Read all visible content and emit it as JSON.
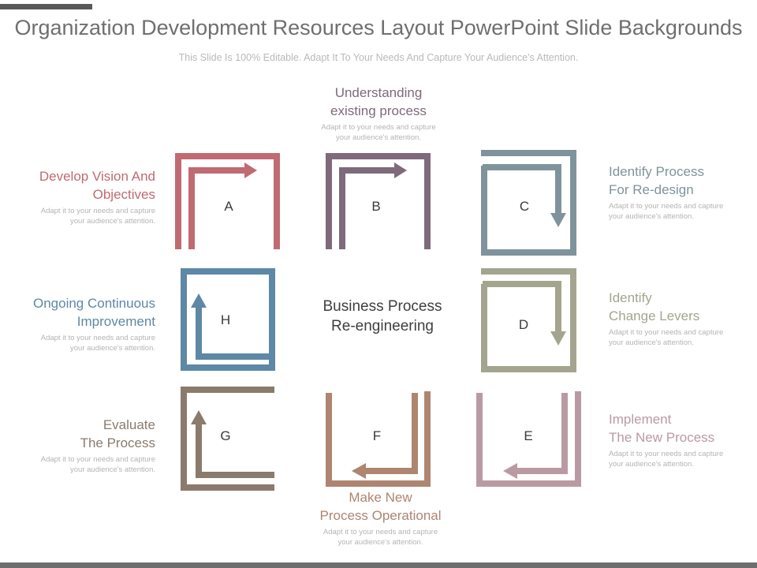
{
  "title": "Organization Development Resources Layout PowerPoint Slide Backgrounds",
  "subtitle": "This Slide Is 100% Editable. Adapt It To Your Needs And Capture Your Audience's Attention.",
  "center": "Business Process\nRe-engineering",
  "steps": [
    {
      "letter": "A",
      "heading": "Develop Vision And\nObjectives",
      "desc": "Adapt it to your needs and capture\nyour audience's attention.",
      "color": "#c06a72"
    },
    {
      "letter": "B",
      "heading": "Understanding\nexisting process",
      "desc": "Adapt it to your needs and capture\nyour audience's attention.",
      "color": "#7e6a7b"
    },
    {
      "letter": "C",
      "heading": "Identify Process\nFor Re-design",
      "desc": "Adapt it to your needs and capture\nyour audience's attention.",
      "color": "#7f939c"
    },
    {
      "letter": "D",
      "heading": "Identify\nChange Levers",
      "desc": "Adapt it to your needs and capture\nyour audience's attention.",
      "color": "#a4a58e"
    },
    {
      "letter": "E",
      "heading": "Implement\nThe New Process",
      "desc": "Adapt it to your needs and capture\nyour audience's attention.",
      "color": "#b99aa3"
    },
    {
      "letter": "F",
      "heading": "Make New\nProcess Operational",
      "desc": "Adapt it to your needs and capture\nyour audience's attention.",
      "color": "#ae8570"
    },
    {
      "letter": "G",
      "heading": "Evaluate\nThe Process",
      "desc": "Adapt it to your needs and capture\nyour audience's attention.",
      "color": "#8a7b6d"
    },
    {
      "letter": "H",
      "heading": "Ongoing Continuous\nImprovement",
      "desc": "Adapt it to your needs and capture\nyour audience's attention.",
      "color": "#5d88a6"
    }
  ]
}
